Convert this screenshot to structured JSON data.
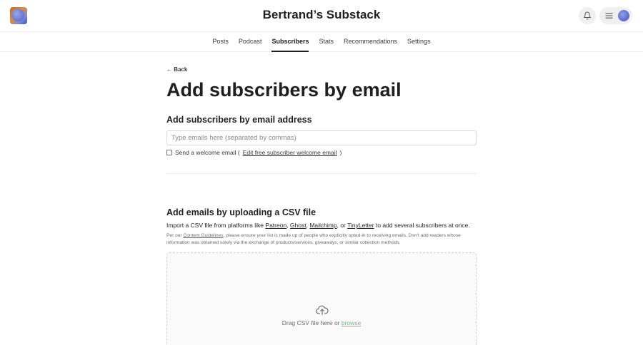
{
  "header": {
    "site_title": "Bertrand’s Substack",
    "icons": {
      "logo": "publication-logo",
      "bell": "bell-icon",
      "menu": "hamburger-icon",
      "avatar": "user-avatar"
    }
  },
  "tabs": [
    {
      "label": "Posts",
      "active": false
    },
    {
      "label": "Podcast",
      "active": false
    },
    {
      "label": "Subscribers",
      "active": true
    },
    {
      "label": "Stats",
      "active": false
    },
    {
      "label": "Recommendations",
      "active": false
    },
    {
      "label": "Settings",
      "active": false
    }
  ],
  "main": {
    "back_label": "← Back",
    "page_title": "Add subscribers by email",
    "email_section": {
      "title": "Add subscribers by email address",
      "input_placeholder": "Type emails here (separated by commas)",
      "checkbox_label": "Send a welcome email (",
      "checkbox_link": "Edit free subscriber welcome email",
      "checkbox_close": ")",
      "checkbox_checked": false
    },
    "csv_section": {
      "title": "Add emails by uploading a CSV file",
      "import_prefix": "Import a CSV file from platforms like ",
      "platforms": [
        "Patreon",
        "Ghost",
        "Mailchimp",
        "TinyLetter"
      ],
      "sep1": ", ",
      "sep2": ", ",
      "sep3": ", or ",
      "import_suffix": " to add several subscribers at once.",
      "guidelines_prefix": "Per our ",
      "guidelines_link": "Content Guidelines",
      "guidelines_suffix": ", please ensure your list is made up of people who explicitly opted-in to receiving emails. Don't add readers whose information was obtained solely via the exchange of products/services, giveaways, or similar collection methods.",
      "drop_text": "Drag CSV file here or ",
      "browse_label": "browse",
      "browse_color": "#6dbf7d"
    }
  }
}
